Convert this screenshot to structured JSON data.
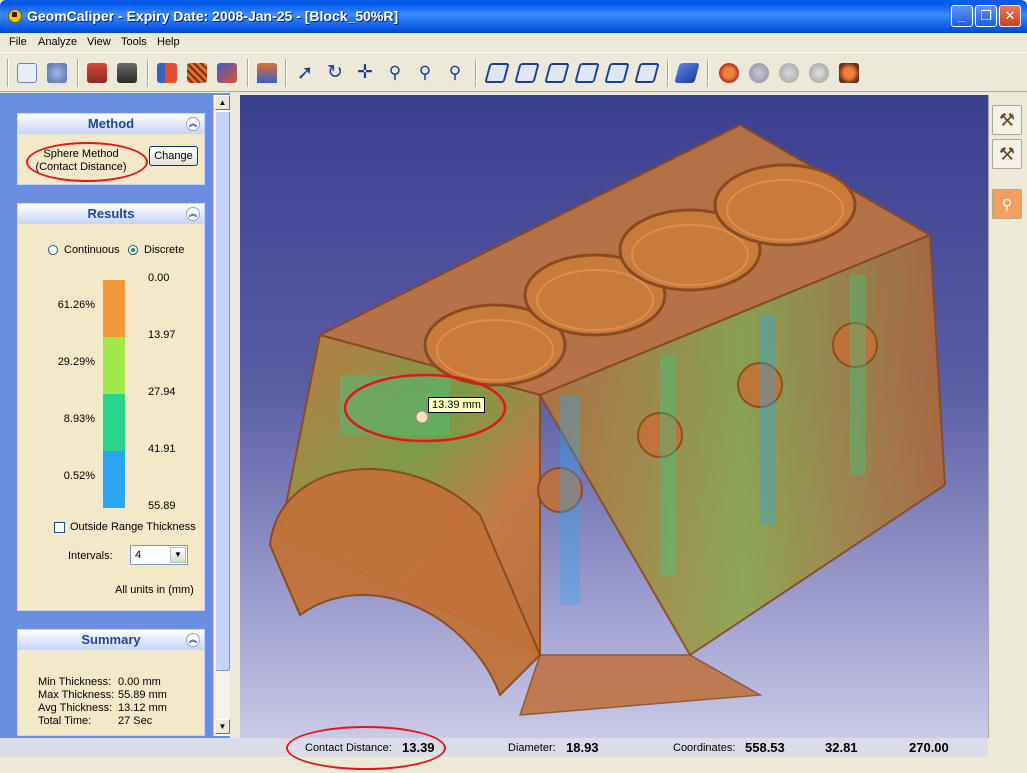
{
  "window": {
    "title": "GeomCaliper  -  Expiry Date: 2008-Jan-25  - [Block_50%R]",
    "min_glyph": "_",
    "max_glyph": "❐",
    "close_glyph": "✕"
  },
  "menu": [
    "File",
    "Analyze",
    "View",
    "Tools",
    "Help"
  ],
  "toolbar": {
    "icons": [
      "report-icon",
      "print-icon",
      "open-icon",
      "save-icon",
      "section-icon",
      "hatch-icon",
      "color-icon",
      "home-icon",
      "select-arrow-icon",
      "rotate-icon",
      "pan-icon",
      "zoom-window-icon",
      "zoom-fit-icon",
      "zoom-in-icon",
      "view-iso-1-icon",
      "view-iso-2-icon",
      "view-iso-3-icon",
      "view-iso-4-icon",
      "view-iso-5-icon",
      "view-iso-6-icon",
      "view-solid-icon",
      "display-mode-1-icon",
      "display-mode-2-icon",
      "display-mode-3-icon",
      "display-mode-4-icon",
      "display-mode-5-icon"
    ]
  },
  "method": {
    "header": "Method",
    "line1": "Sphere Method",
    "line2": "(Contact Distance)",
    "change_button": "Change"
  },
  "results": {
    "header": "Results",
    "mode_continuous": "Continuous",
    "mode_discrete": "Discrete",
    "selected_mode": "Discrete",
    "legend_values": [
      "0.00",
      "13.97",
      "27.94",
      "41.91",
      "55.89"
    ],
    "bands": [
      {
        "percent": "61.26%",
        "color": "#f29a3a"
      },
      {
        "percent": "29.29%",
        "color": "#a3e84a"
      },
      {
        "percent": "8.93%",
        "color": "#2cd38a"
      },
      {
        "percent": "0.52%",
        "color": "#2aa6f0"
      }
    ],
    "outside_range_label": "Outside Range Thickness",
    "outside_range_checked": false,
    "intervals_label": "Intervals:",
    "intervals_value": "4",
    "units_note": "All units in (mm)"
  },
  "summary": {
    "header": "Summary",
    "rows": [
      {
        "label": "Min Thickness:",
        "value": "0.00 mm"
      },
      {
        "label": "Max Thickness:",
        "value": "55.89 mm"
      },
      {
        "label": "Avg Thickness:",
        "value": "13.12 mm"
      },
      {
        "label": "Total Time:",
        "value": "27 Sec"
      }
    ]
  },
  "viewport": {
    "tooltip": "13.39 mm",
    "part_color": "#c8763b"
  },
  "status": {
    "contact_label": "Contact Distance:",
    "contact_value": "13.39",
    "diameter_label": "Diameter:",
    "diameter_value": "18.93",
    "coordinates_label": "Coordinates:",
    "coord_x": "558.53",
    "coord_y": "32.81",
    "coord_z": "270.00"
  },
  "colors": {
    "highlight_red": "#e01818",
    "panel_blue": "#6c8ee0",
    "group_header_text": "#21479a"
  }
}
